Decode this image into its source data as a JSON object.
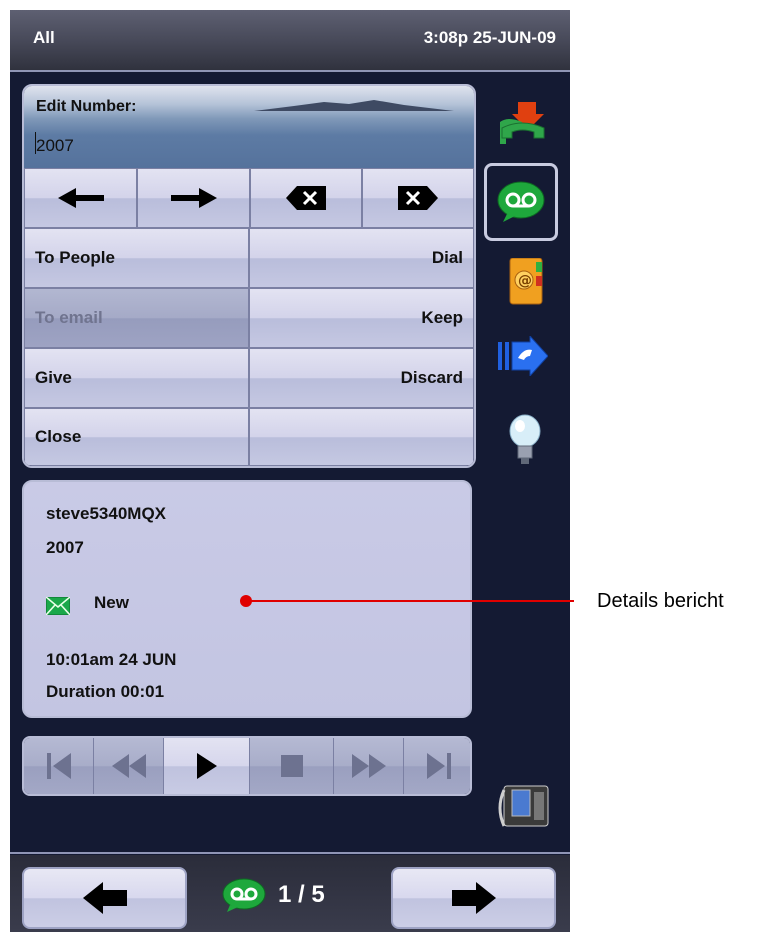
{
  "status": {
    "filter": "All",
    "datetime": "3:08p 25-JUN-09"
  },
  "edit": {
    "label": "Edit Number:",
    "value": "2007"
  },
  "keys": {
    "to_people": "To People",
    "dial": "Dial",
    "to_email": "To email",
    "keep": "Keep",
    "give": "Give",
    "discard": "Discard",
    "close": "Close"
  },
  "message": {
    "sender": "steve5340MQX",
    "number": "2007",
    "status": "New",
    "time": "10:01am  24 JUN",
    "duration": "Duration 00:01"
  },
  "annotation": {
    "label": "Details bericht"
  },
  "pager": {
    "text": "1 / 5"
  },
  "icons": {
    "sidebar": [
      "call-transfer-icon",
      "voicemail-icon",
      "address-book-icon",
      "call-forward-icon",
      "lightbulb-icon"
    ],
    "phone": "desk-phone-icon"
  },
  "colors": {
    "accent": "#e00000",
    "background": "#141a33",
    "key": "#d3d3ea"
  }
}
